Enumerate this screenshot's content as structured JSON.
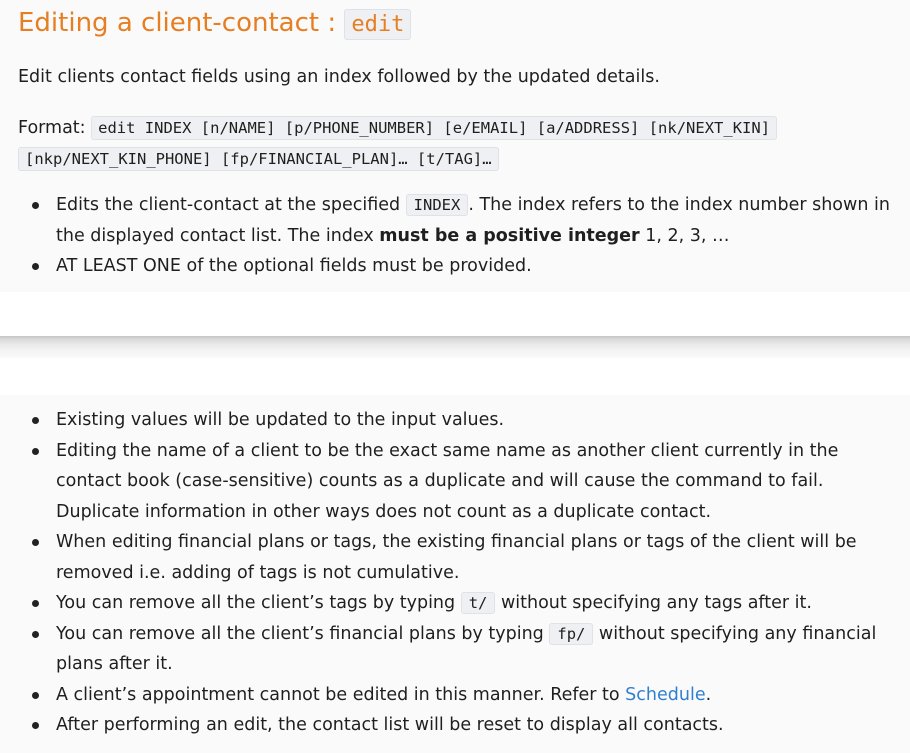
{
  "heading": {
    "text": "Editing a client-contact : ",
    "code": "edit"
  },
  "intro": "Edit clients contact fields using an index followed by the updated details.",
  "format": {
    "label": "Format: ",
    "line1": "edit INDEX [n/NAME] [p/PHONE_NUMBER] [e/EMAIL] [a/ADDRESS] [nk/NEXT_KIN]",
    "line2": "[nkp/NEXT_KIN_PHONE] [fp/FINANCIAL_PLAN]… [t/TAG]…"
  },
  "top_bullets": {
    "b1": {
      "pre": "Edits the client-contact at the specified ",
      "code": "INDEX",
      "mid": ". The index refers to the index number shown in the displayed contact list. The index ",
      "bold": "must be a positive integer",
      "post": " 1, 2, 3, …"
    },
    "b2": "AT LEAST ONE of the optional fields must be provided."
  },
  "bottom_bullets": {
    "b1": "Existing values will be updated to the input values.",
    "b2": "Editing the name of a client to be the exact same name as another client currently in the contact book (case-sensitive) counts as a duplicate and will cause the command to fail. Duplicate information in other ways does not count as a duplicate contact.",
    "b3": "When editing financial plans or tags, the existing financial plans or tags of the client will be removed i.e. adding of tags is not cumulative.",
    "b4": {
      "pre": "You can remove all the client’s tags by typing ",
      "code": "t/",
      "post": " without specifying any tags after it."
    },
    "b5": {
      "pre": "You can remove all the client’s financial plans by typing ",
      "code": "fp/",
      "post": " without specifying any financial plans after it."
    },
    "b6": {
      "pre": "A client’s appointment cannot be edited in this manner. Refer to ",
      "link": "Schedule",
      "post": "."
    },
    "b7": "After performing an edit, the contact list will be reset to display all contacts."
  },
  "colors": {
    "heading": "#e67e22",
    "link": "#2f7fd1",
    "panel": "#fafafb"
  }
}
